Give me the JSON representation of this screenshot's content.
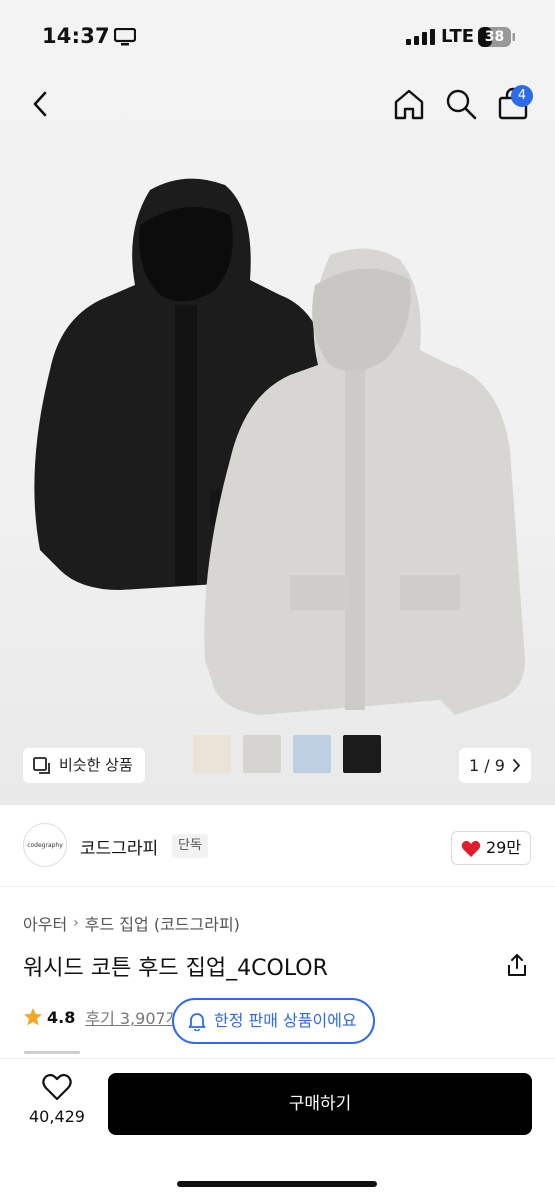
{
  "status_bar": {
    "time": "14:37",
    "network": "LTE",
    "battery": "38"
  },
  "header": {
    "cart_count": "4"
  },
  "colors": {
    "accent": "#2d6bea",
    "like": "#e01f2e",
    "star": "#f5a623",
    "buy_button": "#000000"
  },
  "gallery": {
    "similar_label": "비슷한 상품",
    "page_indicator": "1 / 9",
    "swatches": [
      {
        "name": "cream",
        "color": "#ebe4d6"
      },
      {
        "name": "light-gray",
        "color": "#d6d4d0"
      },
      {
        "name": "sky-blue",
        "color": "#bfcfe2"
      },
      {
        "name": "black",
        "color": "#1b1b1b"
      }
    ]
  },
  "brand": {
    "logo_text": "codegraphy",
    "name": "코드그라피",
    "badge": "단독",
    "likes": "29만"
  },
  "product": {
    "breadcrumb": [
      "아우터",
      "후드 집업 (코드그라피)"
    ],
    "title": "워시드 코튼 후드 집업_4COLOR",
    "rating": "4.8",
    "reviews": "후기 3,907개"
  },
  "notice": {
    "limited_label": "한정 판매 상품이에요"
  },
  "bottom_bar": {
    "wish_count": "40,429",
    "buy_label": "구매하기"
  }
}
